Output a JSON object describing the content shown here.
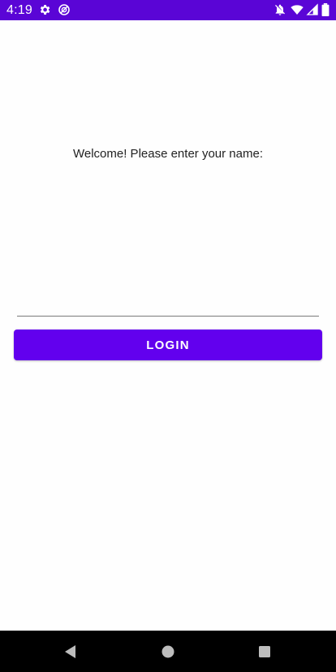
{
  "status_bar": {
    "time": "4:19",
    "left_icons": [
      "gear-icon",
      "no-disturb-icon"
    ],
    "right_icons": [
      "notifications-off-icon",
      "wifi-icon",
      "cellular-icon",
      "battery-icon"
    ],
    "color": "#5a05d6"
  },
  "main": {
    "welcome_text": "Welcome! Please enter your name:",
    "name_input": {
      "value": "",
      "placeholder": ""
    },
    "login_label": "LOGIN",
    "accent_color": "#6200ee"
  },
  "nav_bar": {
    "buttons": [
      "back-icon",
      "home-icon",
      "recents-icon"
    ]
  }
}
